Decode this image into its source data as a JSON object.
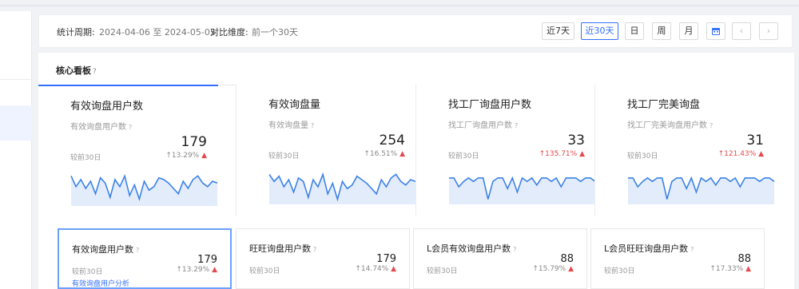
{
  "filter": {
    "period_label": "统计周期:",
    "period_value": "2024-04-06 至 2024-05-05",
    "compare_label": "对比维度:",
    "compare_value": "前一个30天",
    "range_buttons": [
      "近7天",
      "近30天",
      "日",
      "周",
      "月"
    ],
    "active_range": "近30天",
    "prev_icon": "chevron-left-icon",
    "next_icon": "chevron-right-icon",
    "calendar_icon": "calendar-icon"
  },
  "panel": {
    "title": "核心看板",
    "help_icon": "?"
  },
  "compare_text": "较前30日",
  "big_cards": [
    {
      "title": "有效询盘用户数",
      "subtitle": "有效询盘用户数",
      "value": "179",
      "change": "13.29%",
      "trend": "up",
      "change_color": "#888888",
      "series": [
        16,
        10,
        14,
        9,
        13,
        6,
        15,
        12,
        4,
        14,
        10,
        16,
        5,
        11,
        3,
        13,
        8,
        10,
        15,
        14,
        12,
        9,
        6,
        13,
        9,
        14,
        16,
        12,
        10,
        13,
        12
      ]
    },
    {
      "title": "有效询盘量",
      "subtitle": "有效询盘量",
      "value": "254",
      "change": "16.51%",
      "trend": "up",
      "change_color": "#888888",
      "series": [
        16,
        12,
        15,
        9,
        13,
        6,
        14,
        12,
        3,
        13,
        9,
        16,
        5,
        11,
        2,
        12,
        8,
        10,
        15,
        13,
        11,
        8,
        5,
        13,
        9,
        14,
        16,
        12,
        10,
        13,
        12
      ]
    },
    {
      "title": "找工厂询盘用户数",
      "subtitle": "找工厂询盘用户数",
      "value": "33",
      "change": "135.71%",
      "trend": "up",
      "change_color": "#e5484d",
      "series": [
        14,
        14,
        9,
        12,
        14,
        12,
        14,
        14,
        2,
        12,
        14,
        14,
        8,
        14,
        6,
        14,
        12,
        14,
        10,
        14,
        14,
        12,
        14,
        9,
        14,
        14,
        14,
        12,
        14,
        14,
        12
      ]
    },
    {
      "title": "找工厂完美询盘",
      "subtitle": "找工厂完美询盘用户数",
      "value": "31",
      "change": "121.43%",
      "trend": "up",
      "change_color": "#e5484d",
      "series": [
        14,
        14,
        9,
        12,
        14,
        12,
        14,
        14,
        2,
        12,
        14,
        14,
        8,
        14,
        6,
        14,
        12,
        14,
        10,
        14,
        14,
        12,
        14,
        9,
        14,
        14,
        14,
        12,
        14,
        14,
        12
      ]
    }
  ],
  "small_cards": [
    {
      "title": "有效询盘用户数",
      "value": "179",
      "change": "13.29%",
      "trend": "up",
      "link": "有效询盘用户分析"
    },
    {
      "title": "旺旺询盘用户数",
      "value": "179",
      "change": "14.74%",
      "trend": "up"
    },
    {
      "title": "L会员有效询盘用户数",
      "value": "88",
      "change": "15.79%",
      "trend": "up"
    },
    {
      "title": "L会员旺旺询盘用户数",
      "value": "88",
      "change": "17.33%",
      "trend": "up"
    }
  ],
  "colors": {
    "accent": "#3370ff",
    "sparkline": "#3b82e6",
    "sparkfill": "#e3ecfb",
    "up": "#e5484d"
  }
}
